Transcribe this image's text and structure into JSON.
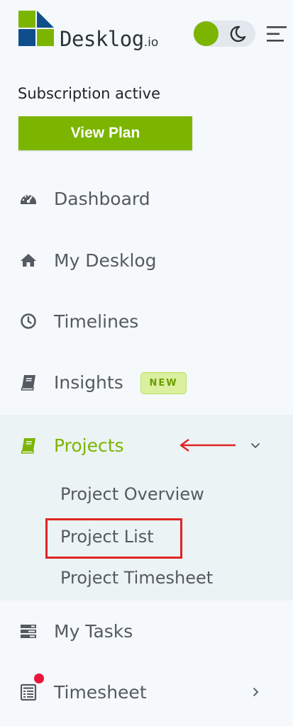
{
  "brand": {
    "name": "Desklog",
    "tld": ".io"
  },
  "header": {
    "theme_toggle": "dark-mode-toggle",
    "menu_icon": "menu-icon"
  },
  "subscription": {
    "status_text": "Subscription active",
    "button_label": "View Plan"
  },
  "nav": {
    "items": [
      {
        "label": "Dashboard",
        "icon": "dashboard-icon"
      },
      {
        "label": "My Desklog",
        "icon": "home-icon"
      },
      {
        "label": "Timelines",
        "icon": "clock-icon"
      },
      {
        "label": "Insights",
        "icon": "book-icon",
        "badge": "NEW"
      },
      {
        "label": "Projects",
        "icon": "book-icon",
        "active": true,
        "expanded": true
      },
      {
        "label": "My Tasks",
        "icon": "tasks-icon"
      },
      {
        "label": "Timesheet",
        "icon": "timesheet-icon",
        "has_notification": true
      }
    ],
    "projects_sub": [
      {
        "label": "Project Overview"
      },
      {
        "label": "Project List"
      },
      {
        "label": "Project Timesheet"
      }
    ]
  },
  "colors": {
    "accent": "#7cb500",
    "annotation": "#e02424",
    "notification": "#e8163c"
  }
}
